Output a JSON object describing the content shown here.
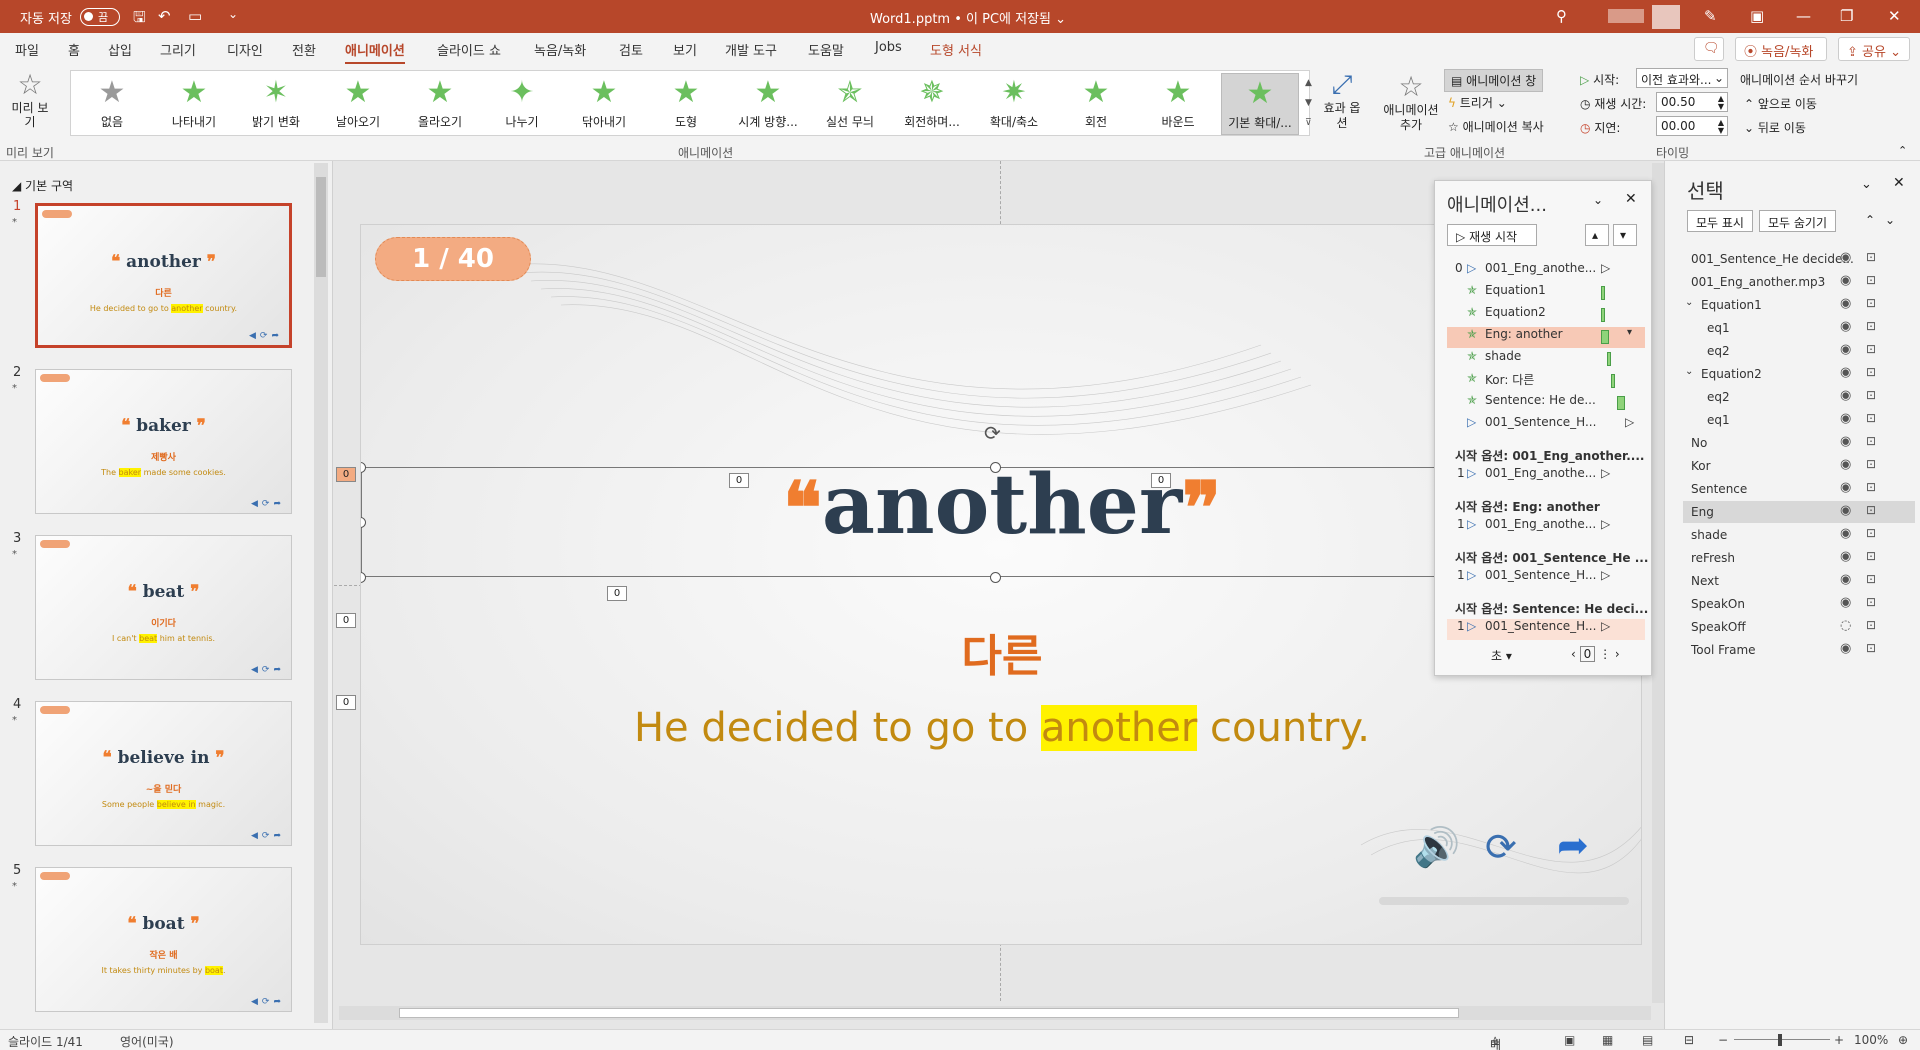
{
  "titlebar": {
    "autosave_label": "자동 저장",
    "autosave_state": "끔",
    "doc_title": "Word1.pptm • 이 PC에 저장됨 ⌄"
  },
  "menu": {
    "tabs": [
      "파일",
      "홈",
      "삽입",
      "그리기",
      "디자인",
      "전환",
      "애니메이션",
      "슬라이드 쇼",
      "녹음/녹화",
      "검토",
      "보기",
      "개발 도구",
      "도움말",
      "Jobs",
      "도형 서식"
    ],
    "record_button": "녹음/녹화",
    "share_button": "공유"
  },
  "ribbon": {
    "preview_label": "미리 보기",
    "preview_group": "미리 보기",
    "animations": [
      "없음",
      "나타내기",
      "밝기 변화",
      "날아오기",
      "올라오기",
      "나누기",
      "닦아내기",
      "도형",
      "시계 방향...",
      "실선 무늬",
      "회전하며...",
      "확대/축소",
      "회전",
      "바운드",
      "기본 확대/..."
    ],
    "effect_options": "효과 옵션",
    "group_animation": "애니메이션",
    "add_animation": "애니메이션 추가",
    "animation_pane": "애니메이션 창",
    "trigger": "트리거",
    "copy_animation": "애니메이션 복사",
    "group_advanced": "고급 애니메이션",
    "start_label": "시작:",
    "start_value": "이전 효과와...",
    "duration_label": "재생 시간:",
    "duration_value": "00.50",
    "delay_label": "지연:",
    "delay_value": "00.00",
    "reorder_label": "애니메이션 순서 바꾸기",
    "move_earlier": "앞으로 이동",
    "move_later": "뒤로 이동",
    "group_timing": "타이밍"
  },
  "thumbnails": {
    "section": "기본 구역",
    "slides": [
      {
        "num": "1",
        "word": "another",
        "kor": "다른",
        "pre": "He decided to go to ",
        "hl": "another",
        "post": " country."
      },
      {
        "num": "2",
        "word": "baker",
        "kor": "제빵사",
        "pre": "The ",
        "hl": "baker",
        "post": " made some cookies."
      },
      {
        "num": "3",
        "word": "beat",
        "kor": "이기다",
        "pre": "I can't ",
        "hl": "beat",
        "post": " him at tennis."
      },
      {
        "num": "4",
        "word": "believe in",
        "kor": "~을 믿다",
        "pre": "Some people ",
        "hl": "believe in",
        "post": " magic."
      },
      {
        "num": "5",
        "word": "boat",
        "kor": "작은 배",
        "pre": "It takes thirty minutes by ",
        "hl": "boat",
        "post": "."
      }
    ]
  },
  "slide": {
    "counter": "1 / 40",
    "word": "another",
    "open_quote": "❝",
    "close_quote": "❞",
    "kor": "다른",
    "sentence_pre": "He decided to go to ",
    "sentence_hl": "another",
    "sentence_post": " country.",
    "tag_zero": "0"
  },
  "animation_pane": {
    "title": "애니메이션...",
    "play": "재생 시작",
    "items": [
      "001_Eng_anothe...",
      "Equation1",
      "Equation2",
      "Eng: another",
      "shade",
      "Kor: 다른",
      "Sentence: He de...",
      "001_Sentence_H..."
    ],
    "first_index": "0",
    "triggers": [
      {
        "head": "시작 옵션: 001_Eng_another....",
        "idx": "1",
        "item": "001_Eng_anothe..."
      },
      {
        "head": "시작 옵션: Eng: another",
        "idx": "1",
        "item": "001_Eng_anothe..."
      },
      {
        "head": "시작 옵션: 001_Sentence_He ...",
        "idx": "1",
        "item": "001_Sentence_H..."
      },
      {
        "head": "시작 옵션: Sentence: He deci...",
        "idx": "1",
        "item": "001_Sentence_H..."
      }
    ],
    "seconds": "초 ▾",
    "page_value": "0"
  },
  "selection_pane": {
    "title": "선택",
    "show_all": "모두 표시",
    "hide_all": "모두 숨기기",
    "items": [
      {
        "label": "001_Sentence_He decide...",
        "indent": 0
      },
      {
        "label": "001_Eng_another.mp3",
        "indent": 0
      },
      {
        "label": "Equation1",
        "indent": 0,
        "group": true
      },
      {
        "label": "eq1",
        "indent": 1
      },
      {
        "label": "eq2",
        "indent": 1
      },
      {
        "label": "Equation2",
        "indent": 0,
        "group": true
      },
      {
        "label": "eq2",
        "indent": 1
      },
      {
        "label": "eq1",
        "indent": 1
      },
      {
        "label": "No",
        "indent": 0
      },
      {
        "label": "Kor",
        "indent": 0
      },
      {
        "label": "Sentence",
        "indent": 0
      },
      {
        "label": "Eng",
        "indent": 0,
        "selected": true
      },
      {
        "label": "shade",
        "indent": 0
      },
      {
        "label": "reFresh",
        "indent": 0
      },
      {
        "label": "Next",
        "indent": 0
      },
      {
        "label": "SpeakOn",
        "indent": 0
      },
      {
        "label": "SpeakOff",
        "indent": 0,
        "hidden": true
      },
      {
        "label": "Tool Frame",
        "indent": 0
      }
    ]
  },
  "statusbar": {
    "slide_info": "슬라이드 1/41",
    "language": "영어(미국)",
    "notes": "메모",
    "zoom": "100%"
  },
  "colors": {
    "accent": "#b7472a",
    "word": "#2d3e50",
    "orange": "#f07e30",
    "sentence": "#c28a10",
    "highlight": "#fff200"
  }
}
